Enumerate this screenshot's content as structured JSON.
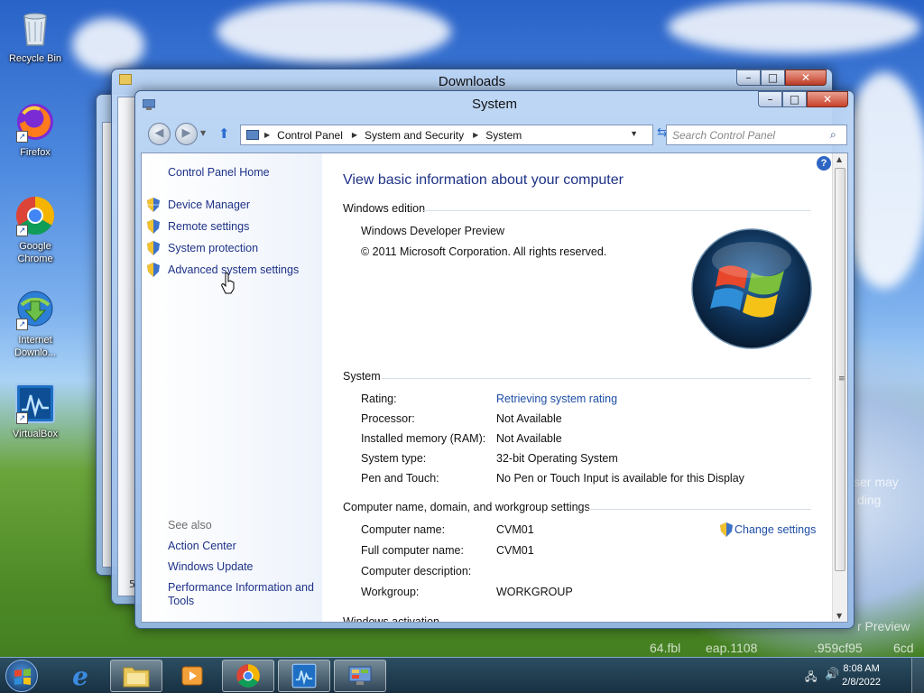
{
  "desktop": {
    "icons": [
      {
        "label": "Recycle Bin",
        "icon": "recycle-bin-icon"
      },
      {
        "label": "Firefox",
        "icon": "firefox-icon"
      },
      {
        "label": "Google Chrome",
        "icon": "chrome-icon"
      },
      {
        "label": "Internet Downlo...",
        "icon": "internet-download-manager-icon"
      },
      {
        "label": "VirtualBox",
        "icon": "virtualbox-icon"
      }
    ],
    "wallpaper_text": [
      "ser may",
      "ding",
      "r Preview",
      "64.fbl",
      "eap.1108",
      ".959cf95",
      "6cd"
    ]
  },
  "downloads_window": {
    "title": "Downloads",
    "status_fragment": "5"
  },
  "system_window": {
    "title": "System",
    "address": {
      "root": "Control Panel",
      "crumbs": [
        "Control Panel",
        "System and Security",
        "System"
      ]
    },
    "search_placeholder": "Search Control Panel",
    "left_pane": {
      "home": "Control Panel Home",
      "links": [
        "Device Manager",
        "Remote settings",
        "System protection",
        "Advanced system settings"
      ],
      "see_also_label": "See also",
      "see_also": [
        "Action Center",
        "Windows Update",
        "Performance Information and Tools"
      ]
    },
    "content": {
      "heading": "View basic information about your computer",
      "edition": {
        "section": "Windows edition",
        "name": "Windows Developer Preview",
        "copyright": "© 2011 Microsoft Corporation. All rights reserved."
      },
      "system": {
        "section": "System",
        "rows": [
          {
            "label": "Rating:",
            "value": "Retrieving system rating",
            "link": true
          },
          {
            "label": "Processor:",
            "value": "Not Available"
          },
          {
            "label": "Installed memory (RAM):",
            "value": "Not Available"
          },
          {
            "label": "System type:",
            "value": "32-bit Operating System"
          },
          {
            "label": "Pen and Touch:",
            "value": "No Pen or Touch Input is available for this Display"
          }
        ]
      },
      "computer": {
        "section": "Computer name, domain, and workgroup settings",
        "change_link": "Change settings",
        "rows": [
          {
            "label": "Computer name:",
            "value": "CVM01"
          },
          {
            "label": "Full computer name:",
            "value": "CVM01"
          },
          {
            "label": "Computer description:",
            "value": ""
          },
          {
            "label": "Workgroup:",
            "value": "WORKGROUP"
          }
        ]
      },
      "activation": {
        "section": "Windows activation"
      }
    }
  },
  "taskbar": {
    "clock_time": "8:08 AM",
    "clock_date": "2/8/2022"
  },
  "colors": {
    "link": "#1e4ea6",
    "nav_link": "#1e3287"
  }
}
